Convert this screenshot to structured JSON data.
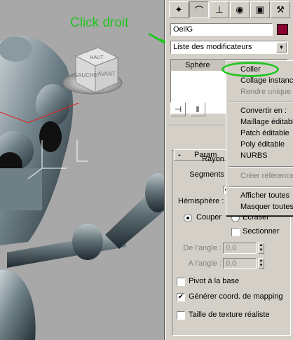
{
  "annotation": {
    "text": "Click droit",
    "color": "#22c522"
  },
  "viewcube": {
    "face_top": "HAUT",
    "face_left": "GAUCHE",
    "face_right": "AVANT"
  },
  "tabs": [
    {
      "icon": "cursor-icon"
    },
    {
      "icon": "modify-icon"
    },
    {
      "icon": "hierarchy-icon"
    },
    {
      "icon": "motion-icon"
    },
    {
      "icon": "display-icon"
    },
    {
      "icon": "utilities-icon"
    }
  ],
  "object": {
    "name": "OeilG",
    "color": "#8b0033"
  },
  "modifier_list": {
    "label": "Liste des modificateurs"
  },
  "stack": {
    "item": "Sphère"
  },
  "context_menu": {
    "items": [
      {
        "label": "Coller",
        "state": "highlight"
      },
      {
        "label": "Collage instancié",
        "state": "normal"
      },
      {
        "label": "Rendre unique",
        "state": "disabled"
      },
      {
        "label": "Convertir en :",
        "state": "normal"
      },
      {
        "label": "Maillage éditable",
        "state": "normal"
      },
      {
        "label": "Patch éditable",
        "state": "normal"
      },
      {
        "label": "Poly éditable",
        "state": "normal"
      },
      {
        "label": "NURBS",
        "state": "normal"
      },
      {
        "label": "Créer référence",
        "state": "disabled"
      },
      {
        "label": "Afficher toutes",
        "state": "normal"
      },
      {
        "label": "Masquer toutes",
        "state": "normal"
      }
    ]
  },
  "params": {
    "header": "Param",
    "rayon_label": "Rayon :",
    "segments_label": "Segments :",
    "hemisphere_label": "Hémisphère :",
    "couper_label": "Couper",
    "ecraser_label": "Ecraser",
    "sectionner_label": "Sectionner",
    "de_angle_label": "De l'angle :",
    "de_angle_value": "0,0",
    "a_angle_label": "A l'angle :",
    "a_angle_value": "0,0",
    "pivot_label": "Pivot à la base",
    "generer_label": "Générer coord. de mapping",
    "taille_label": "Taille de texture réaliste"
  }
}
